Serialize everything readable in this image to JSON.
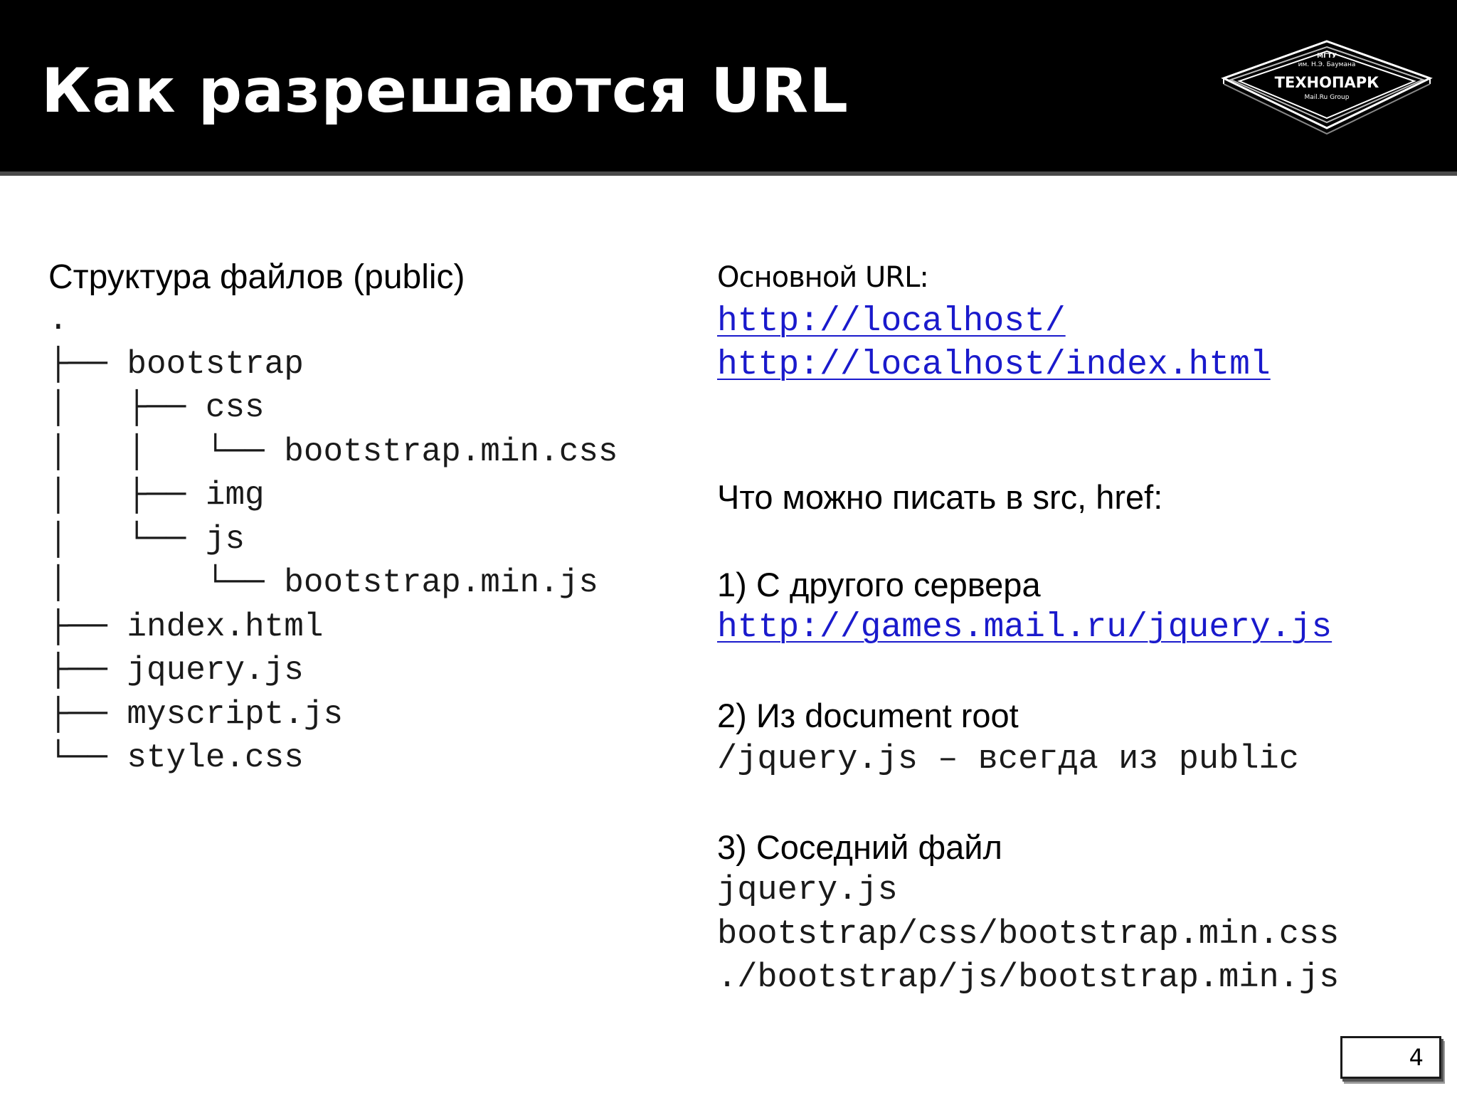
{
  "slide": {
    "title": "Как разрешаются URL",
    "logo": {
      "line1": "МГТУ",
      "line2": "им. Н.Э. Баумана",
      "name": "ТЕХНОПАРК",
      "line4": "Mail.Ru Group"
    },
    "page_number": "4"
  },
  "left": {
    "heading": "Структура файлов (public)",
    "tree": [
      ".",
      "├── bootstrap",
      "│   ├── css",
      "│   │   └── bootstrap.min.css",
      "│   ├── img",
      "│   └── js",
      "│       └── bootstrap.min.js",
      "├── index.html",
      "├── jquery.js",
      "├── myscript.js",
      "└── style.css"
    ]
  },
  "right": {
    "main_url_heading": "Основной URL:",
    "main_urls": [
      "http://localhost/",
      "http://localhost/index.html"
    ],
    "src_href_heading": "Что можно писать в src, href:",
    "case1_heading": "1) С другого сервера",
    "case1_link": "http://games.mail.ru/jquery.js",
    "case2_heading": "2) Из document root",
    "case2_text": "/jquery.js – всегда из public",
    "case3_heading": "3) Соседний файл",
    "case3_lines": [
      "jquery.js",
      "bootstrap/css/bootstrap.min.css",
      "./bootstrap/js/bootstrap.min.js"
    ]
  },
  "colors": {
    "header_bg": "#000000",
    "link": "#1a1acc",
    "text": "#000000"
  }
}
